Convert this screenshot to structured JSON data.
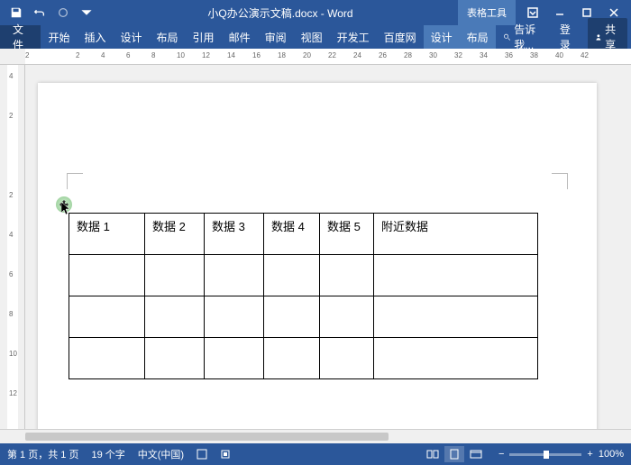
{
  "titlebar": {
    "document_title": "小Q办公演示文稿.docx - Word",
    "table_tools": "表格工具"
  },
  "ribbon": {
    "file": "文件",
    "tabs": [
      "开始",
      "插入",
      "设计",
      "布局",
      "引用",
      "邮件",
      "审阅",
      "视图",
      "开发工",
      "百度网"
    ],
    "context_tabs": [
      "设计",
      "布局"
    ],
    "tell_me": "告诉我...",
    "login": "登录",
    "share": "共享"
  },
  "ruler_h": [
    "2",
    "",
    "2",
    "4",
    "6",
    "8",
    "10",
    "12",
    "14",
    "16",
    "18",
    "20",
    "22",
    "24",
    "26",
    "28",
    "30",
    "32",
    "34",
    "36",
    "38",
    "40",
    "42"
  ],
  "ruler_v": [
    "4",
    "2",
    "",
    "2",
    "4",
    "6",
    "8",
    "10",
    "12"
  ],
  "table": {
    "headers": [
      "数据 1",
      "数据 2",
      "数据 3",
      "数据 4",
      "数据 5",
      "附近数据"
    ]
  },
  "statusbar": {
    "page": "第 1 页，共 1 页",
    "words": "19 个字",
    "language": "中文(中国)",
    "zoom_pct": "100%"
  }
}
